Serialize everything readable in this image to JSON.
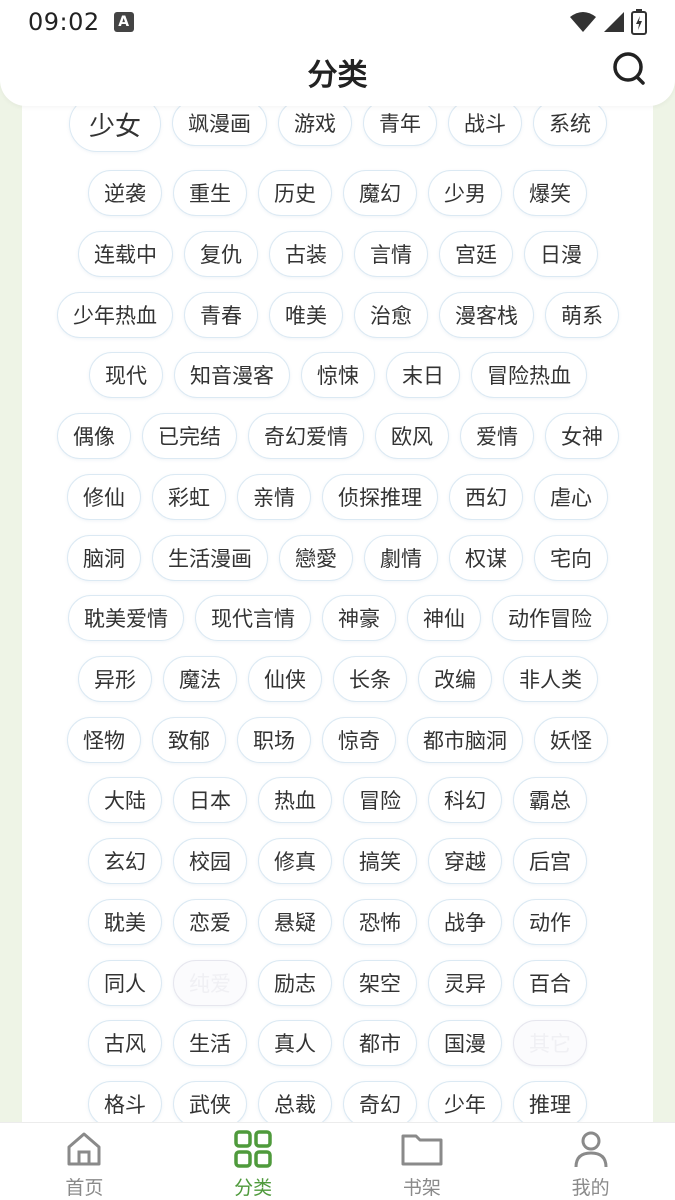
{
  "status": {
    "time": "09:02",
    "a_icon": "A"
  },
  "header": {
    "title": "分类"
  },
  "tags": [
    [
      "少女",
      "飒漫画",
      "游戏",
      "青年",
      "战斗",
      "系统"
    ],
    [
      "逆袭",
      "重生",
      "历史",
      "魔幻",
      "少男",
      "爆笑"
    ],
    [
      "连载中",
      "复仇",
      "古装",
      "言情",
      "宫廷",
      "日漫"
    ],
    [
      "少年热血",
      "青春",
      "唯美",
      "治愈",
      "漫客栈",
      "萌系"
    ],
    [
      "现代",
      "知音漫客",
      "惊悚",
      "末日",
      "冒险热血"
    ],
    [
      "偶像",
      "已完结",
      "奇幻爱情",
      "欧风",
      "爱情",
      "女神"
    ],
    [
      "修仙",
      "彩虹",
      "亲情",
      "侦探推理",
      "西幻",
      "虐心"
    ],
    [
      "脑洞",
      "生活漫画",
      "戀愛",
      "劇情",
      "权谋",
      "宅向"
    ],
    [
      "耽美爱情",
      "现代言情",
      "神豪",
      "神仙",
      "动作冒险"
    ],
    [
      "异形",
      "魔法",
      "仙侠",
      "长条",
      "改编",
      "非人类"
    ],
    [
      "怪物",
      "致郁",
      "职场",
      "惊奇",
      "都市脑洞",
      "妖怪"
    ],
    [
      "大陆",
      "日本",
      "热血",
      "冒险",
      "科幻",
      "霸总"
    ],
    [
      "玄幻",
      "校园",
      "修真",
      "搞笑",
      "穿越",
      "后宫"
    ],
    [
      "耽美",
      "恋爱",
      "悬疑",
      "恐怖",
      "战争",
      "动作"
    ],
    [
      "同人",
      "纯爱",
      "励志",
      "架空",
      "灵异",
      "百合"
    ],
    [
      "古风",
      "生活",
      "真人",
      "都市",
      "国漫",
      "其它"
    ],
    [
      "格斗",
      "武侠",
      "总裁",
      "奇幻",
      "少年",
      "推理"
    ]
  ],
  "nav": [
    {
      "label": "首页",
      "icon": "home-icon",
      "active": false
    },
    {
      "label": "分类",
      "icon": "category-grid-icon",
      "active": true
    },
    {
      "label": "书架",
      "icon": "folder-icon",
      "active": false
    },
    {
      "label": "我的",
      "icon": "profile-icon",
      "active": false
    }
  ],
  "colors": {
    "accent": "#4f9a3c",
    "inactive": "#8a8a8a",
    "tag_border": "#dbe9f3",
    "background": "#eef4e6"
  }
}
